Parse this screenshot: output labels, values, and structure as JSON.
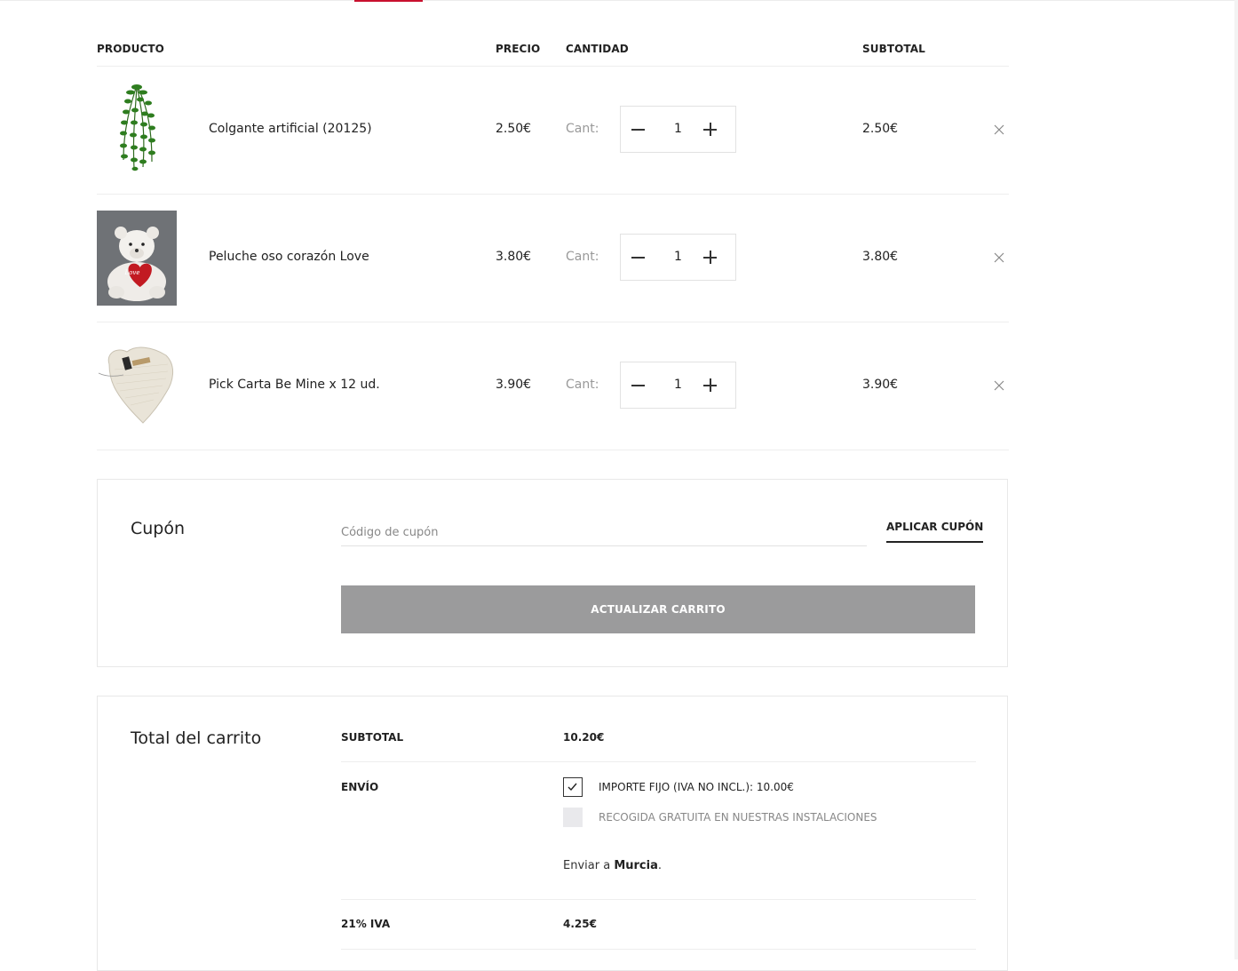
{
  "table": {
    "headers": {
      "product": "PRODUCTO",
      "price": "PRECIO",
      "quantity": "CANTIDAD",
      "subtotal": "SUBTOTAL"
    },
    "rows": [
      {
        "name": "Colgante artificial (20125)",
        "price": "2.50€",
        "qty_label": "Cant:",
        "qty": "1",
        "subtotal": "2.50€",
        "image": "hanging-plant-image"
      },
      {
        "name": "Peluche oso corazón Love",
        "price": "3.80€",
        "qty_label": "Cant:",
        "qty": "1",
        "subtotal": "3.80€",
        "image": "teddy-bear-image"
      },
      {
        "name": "Pick Carta Be Mine x 12 ud.",
        "price": "3.90€",
        "qty_label": "Cant:",
        "qty": "1",
        "subtotal": "3.90€",
        "image": "heart-card-image"
      }
    ]
  },
  "coupon": {
    "title": "Cupón",
    "placeholder": "Código de cupón",
    "apply_label": "APLICAR CUPÓN",
    "update_label": "ACTUALIZAR CARRITO"
  },
  "totals": {
    "title": "Total del carrito",
    "subtotal_label": "SUBTOTAL",
    "subtotal_value": "10.20€",
    "shipping_label": "ENVÍO",
    "shipping_options": [
      {
        "label": "IMPORTE FIJO (IVA NO INCL.): 10.00€",
        "selected": true
      },
      {
        "label": "RECOGIDA GRATUITA EN NUESTRAS INSTALACIONES",
        "selected": false
      }
    ],
    "ship_to_prefix": "Enviar a",
    "ship_to_place": "Murcia",
    "ship_to_suffix": ".",
    "tax_label": "21% IVA",
    "tax_value": "4.25€"
  },
  "colors": {
    "accent": "#c8102e",
    "update_button": "#9b9b9c",
    "text": "#222222",
    "muted": "#999999"
  }
}
